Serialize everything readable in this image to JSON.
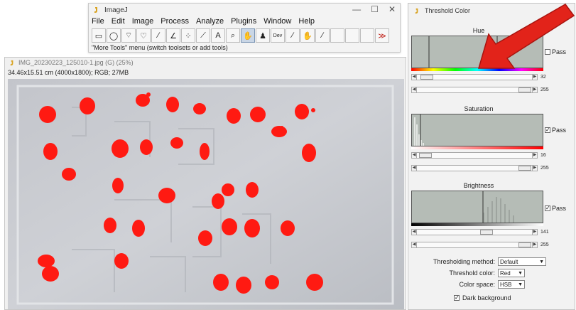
{
  "imagej": {
    "title": "ImageJ",
    "menu": [
      "File",
      "Edit",
      "Image",
      "Process",
      "Analyze",
      "Plugins",
      "Window",
      "Help"
    ],
    "tools": [
      "rectangle-tool",
      "oval-tool",
      "polygon-tool",
      "freehand-tool",
      "line-tool",
      "angle-tool",
      "point-tool",
      "wand-tool",
      "text-tool",
      "magnifier-tool",
      "scroll-tool",
      "color-picker-tool",
      "dev-tool",
      "brush-tool",
      "flood-fill-tool",
      "dropper-tool",
      "blank-tool-1",
      "blank-tool-2",
      "blank-tool-3",
      "more-tools"
    ],
    "tool_glyphs": [
      "▭",
      "◯",
      "⌔",
      "♡",
      "∕",
      "∠",
      "⁘",
      "⟋",
      "A",
      "⌕",
      "✋",
      "♟",
      "Dev",
      "∕",
      "✋",
      "∕",
      "",
      "",
      "",
      "≫"
    ],
    "status": "\"More Tools\" menu (switch toolsets or add tools)"
  },
  "image_window": {
    "title": "IMG_20230223_125010-1.jpg (G) (25%)",
    "info": "34.46x15.51 cm (4000x1800); RGB; 27MB"
  },
  "threshold": {
    "title": "Threshold Color",
    "hue": {
      "label": "Hue",
      "min": "32",
      "max": "255",
      "pass": "Pass",
      "pass_checked": false
    },
    "saturation": {
      "label": "Saturation",
      "min": "16",
      "max": "255",
      "pass": "Pass",
      "pass_checked": true
    },
    "brightness": {
      "label": "Brightness",
      "min": "141",
      "max": "255",
      "pass": "Pass",
      "pass_checked": true
    },
    "method_label": "Thresholding method:",
    "method_value": "Default",
    "color_label": "Threshold color:",
    "color_value": "Red",
    "space_label": "Color space:",
    "space_value": "HSB",
    "dark_bg_label": "Dark background",
    "dark_bg_checked": true
  },
  "colors": {
    "blob": "#ff1a12",
    "arrow": "#e2231a",
    "hist_bg": "#b5bcb6"
  }
}
